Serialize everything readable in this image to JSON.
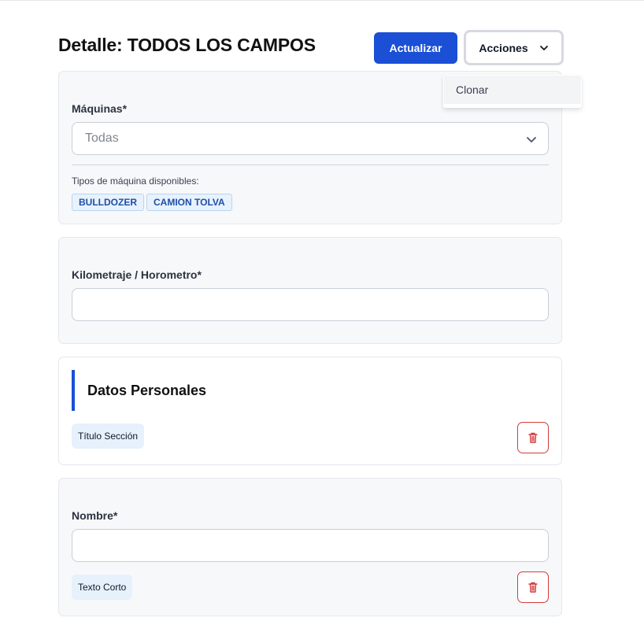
{
  "page": {
    "title": "Detalle: TODOS LOS CAMPOS"
  },
  "header": {
    "update_label": "Actualizar",
    "actions_label": "Acciones",
    "actions_menu": [
      {
        "label": "Clonar"
      }
    ]
  },
  "machines_card": {
    "label": "Máquinas*",
    "select_value": "Todas",
    "available_label": "Tipos de máquina disponibles:",
    "machine_types": [
      "BULLDOZER",
      "CAMION TOLVA"
    ]
  },
  "km_card": {
    "label": "Kilometraje / Horometro*",
    "value": ""
  },
  "section_card": {
    "title": "Datos Personales",
    "type_tag": "Título Sección"
  },
  "name_card": {
    "label": "Nombre*",
    "value": "",
    "type_tag": "Texto Corto"
  },
  "colors": {
    "primary": "#1a4fd6",
    "danger": "#d43c3c",
    "chip_bg": "#e8f2fd",
    "card_bg": "#f7f8fa"
  }
}
